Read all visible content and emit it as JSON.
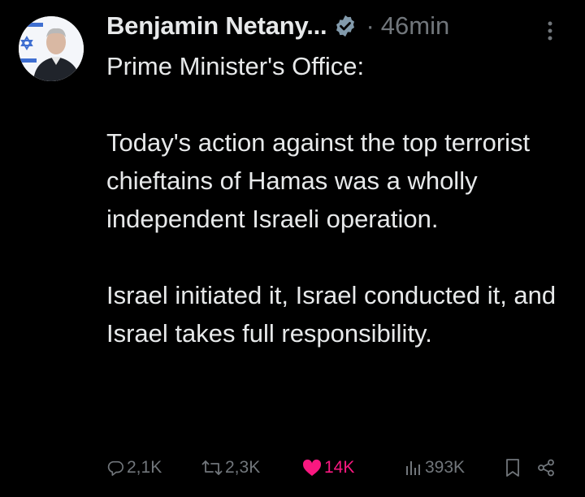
{
  "tweet": {
    "author_name": "Benjamin Netany...",
    "separator": "·",
    "timestamp": "46min",
    "body_lines": [
      "Prime Minister's Office:",
      "",
      "Today's action against the top terrorist chieftains of Hamas was a wholly independent Israeli operation.",
      "",
      "Israel initiated it, Israel conducted it, and Israel takes full responsibility."
    ]
  },
  "metrics": {
    "replies": "2,1K",
    "reposts": "2,3K",
    "likes": "14K",
    "views": "393K"
  },
  "icons": {
    "avatar": "profile-photo",
    "verified": "verified-badge-icon",
    "more": "more-vertical-icon",
    "reply": "reply-icon",
    "repost": "repost-icon",
    "like": "heart-icon",
    "views": "views-bar-icon",
    "bookmark": "bookmark-icon",
    "share": "share-icon"
  },
  "colors": {
    "background": "#000000",
    "text": "#e7e9ea",
    "muted": "#71767b",
    "like_active": "#f91880",
    "verified_badge": "#829aab"
  }
}
